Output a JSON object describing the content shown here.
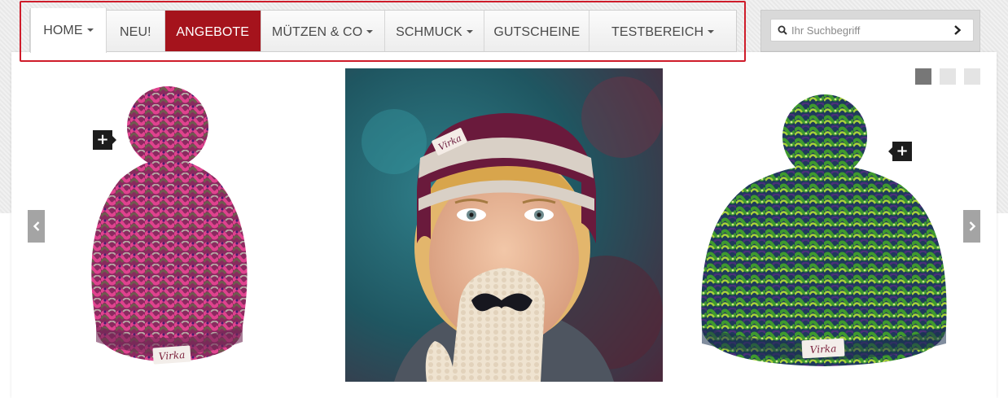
{
  "nav": {
    "items": [
      {
        "label": "HOME",
        "dropdown": true,
        "state": "current"
      },
      {
        "label": "NEU!",
        "dropdown": false
      },
      {
        "label": "ANGEBOTE",
        "dropdown": false,
        "state": "active"
      },
      {
        "label": "MÜTZEN & CO",
        "dropdown": true
      },
      {
        "label": "SCHMUCK",
        "dropdown": true
      },
      {
        "label": "GUTSCHEINE",
        "dropdown": false
      },
      {
        "label": "TESTBEREICH",
        "dropdown": true
      }
    ]
  },
  "search": {
    "placeholder": "Ihr Suchbegriff",
    "icon": "search-icon",
    "submit_icon": "chevron-right-icon"
  },
  "slider": {
    "page_indicator_count": 3,
    "active_page": 1,
    "prev_icon": "chevron-left-icon",
    "next_icon": "chevron-right-icon",
    "slides": [
      {
        "kind": "product",
        "description": "pink knitted beanie with pom-pom",
        "label_text": "Virka"
      },
      {
        "kind": "photo",
        "description": "woman wearing striped headband holding mustache mitten",
        "label_text": "Virka"
      },
      {
        "kind": "product",
        "description": "green knitted beanie with pom-pom",
        "label_text": "Virka"
      }
    ]
  },
  "colors": {
    "accent": "#a5131c",
    "highlight_outline": "#cf1c2a",
    "nav_text": "#4a4a4a",
    "arrow_bg": "#a4a4a4",
    "dot_active": "#777777",
    "dot_inactive": "#e4e4e4"
  }
}
